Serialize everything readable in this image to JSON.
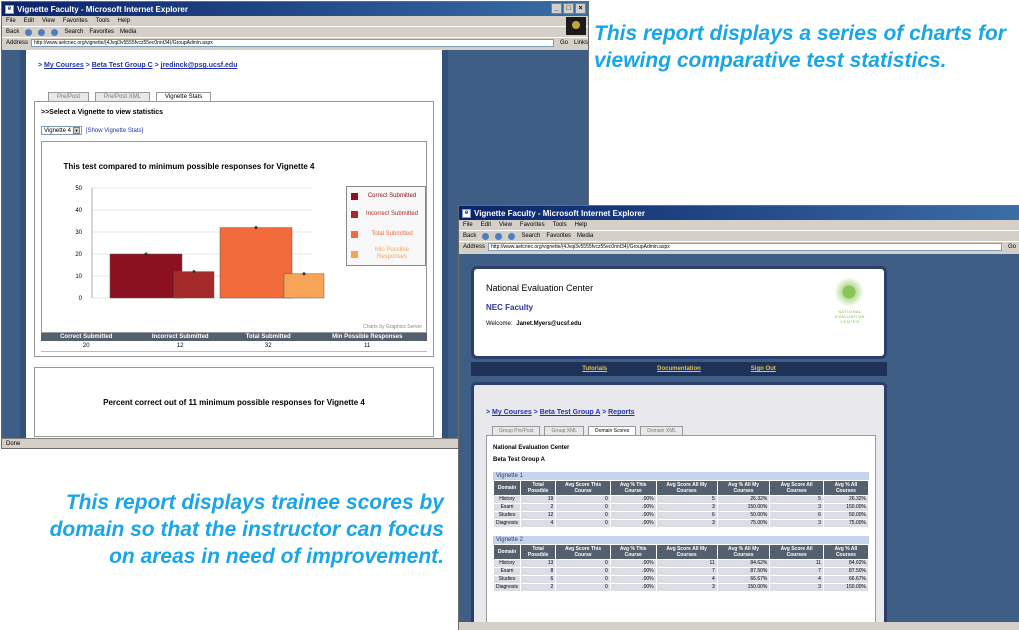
{
  "window1": {
    "title": "Vignette Faculty - Microsoft Internet Explorer",
    "menu": [
      "File",
      "Edit",
      "View",
      "Favorites",
      "Tools",
      "Help"
    ],
    "toolbar": [
      "Back",
      "Search",
      "Favorites",
      "Media"
    ],
    "address_label": "Address",
    "address_value": "http://www.aetcnec.org/vignette/(4Jvqi3v5555fvcz55ec0nnt34)/GroupAdmin.aspx",
    "go_label": "Go",
    "links_label": "Links",
    "breadcrumb": [
      "My Courses",
      "Beta Test Group C",
      "jredinck@psg.ucsf.edu"
    ],
    "tabs": [
      "Pre/Post",
      "Pre/Post XML",
      "Vignette Stats"
    ],
    "select_heading": ">>Select a Vignette to view statistics",
    "select_value": "Vignette 4",
    "show_link": "[Show Vignette Stats]",
    "chart_credit": "Charts by Graphics Server",
    "table": {
      "headers": [
        "Correct Submitted",
        "Incorrect Submitted",
        "Total Submitted",
        "Min Possible Responses"
      ],
      "values": [
        "20",
        "12",
        "32",
        "11"
      ]
    },
    "second_chart_title": "Percent correct out of 11 minimum possible responses for Vignette 4",
    "status": "Done"
  },
  "chart_data": {
    "type": "bar",
    "title": "This test compared to minimum possible responses for Vignette 4",
    "categories": [
      "Correct Submitted",
      "Incorrect Submitted",
      "Total Submitted",
      "Min Possible Responses"
    ],
    "values": [
      20,
      12,
      32,
      11
    ],
    "colors": [
      "#8b1020",
      "#a52a2a",
      "#f26b3a",
      "#f7a457"
    ],
    "ylim": [
      0,
      50
    ],
    "yticks": [
      "0",
      "10",
      "20",
      "30",
      "40",
      "50"
    ],
    "legend": [
      "Correct Submitted",
      "Incorrect Submitted",
      "Total Submitted",
      "Min Possible Responses"
    ],
    "legend_placement": "right",
    "grid": true
  },
  "window2": {
    "title": "Vignette Faculty - Microsoft Internet Explorer",
    "address_value": "http://www.aetcnec.org/vignette/(4Jvqi3v5555fvcz55ec0nnt34)/GroupAdmin.aspx",
    "org_name": "National Evaluation Center",
    "faculty": "NEC Faculty",
    "welcome_label": "Welcome:",
    "welcome_user": "Janet.Myers@ucsf.edu",
    "logo_text": [
      "NATIONAL",
      "EVALUATION",
      "CENTER"
    ],
    "nav": [
      "Tutorials",
      "Documentation",
      "Sign Out"
    ],
    "breadcrumb": [
      "My Courses",
      "Beta Test Group A",
      "Reports"
    ],
    "tabs": [
      "Group Pre/Post",
      "Group XML",
      "Domain Scores",
      "Domain XML"
    ],
    "report_org": "National Evaluation Center",
    "report_group": "Beta Test Group A",
    "columns": [
      "Domain",
      "Total Possible",
      "Avg Score This Course",
      "Avg % This Course",
      "Avg Score All My Courses",
      "Avg % All My Courses",
      "Avg Score All Courses",
      "Avg % All Courses"
    ],
    "vignettes": [
      {
        "name": "Vignette 1",
        "rows": [
          [
            "History",
            "19",
            "0",
            ".00%",
            "5",
            "26.32%",
            "5",
            "26.32%"
          ],
          [
            "Exam",
            "2",
            "0",
            ".00%",
            "3",
            "150.00%",
            "3",
            "150.00%"
          ],
          [
            "Studies",
            "12",
            "0",
            ".00%",
            "6",
            "50.00%",
            "6",
            "50.00%"
          ],
          [
            "Diagnosis",
            "4",
            "0",
            ".00%",
            "3",
            "75.00%",
            "3",
            "75.00%"
          ]
        ]
      },
      {
        "name": "Vignette 2",
        "rows": [
          [
            "History",
            "13",
            "0",
            ".00%",
            "11",
            "84.62%",
            "11",
            "84.62%"
          ],
          [
            "Exam",
            "8",
            "0",
            ".00%",
            "7",
            "87.50%",
            "7",
            "87.50%"
          ],
          [
            "Studies",
            "6",
            "0",
            ".00%",
            "4",
            "66.67%",
            "4",
            "66.67%"
          ],
          [
            "Diagnosis",
            "2",
            "0",
            ".00%",
            "3",
            "150.00%",
            "3",
            "150.00%"
          ]
        ]
      }
    ]
  },
  "captions": {
    "top": "This report displays a series of charts for viewing comparative test statistics.",
    "bottom": "This report displays trainee scores by domain so that the instructor can focus on areas in need of improvement."
  }
}
